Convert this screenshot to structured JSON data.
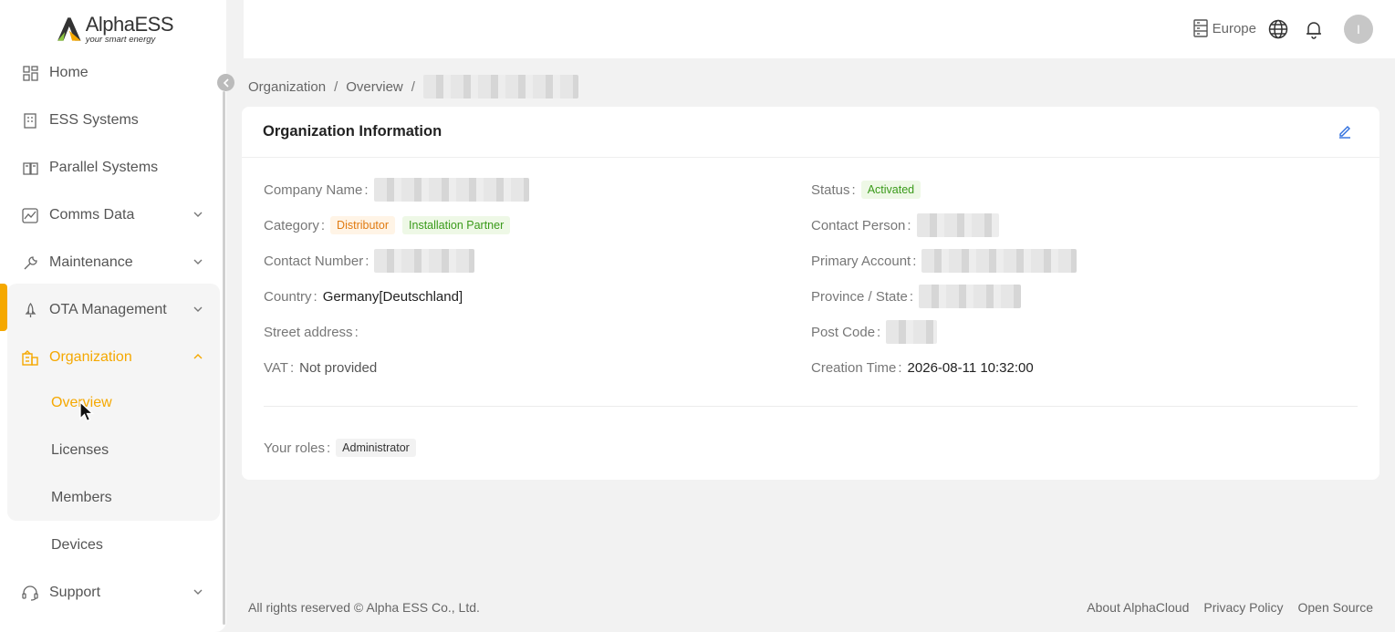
{
  "app": {
    "brand": "AlphaESS",
    "tagline": "your smart energy",
    "accent_color": "#f5a800"
  },
  "header": {
    "region": "Europe",
    "avatar_initial": "I",
    "icons": [
      "server-icon",
      "globe-icon",
      "bell-icon"
    ]
  },
  "sidebar": {
    "items": [
      {
        "label": "Home",
        "icon": "dashboard-icon"
      },
      {
        "label": "ESS Systems",
        "icon": "building-icon"
      },
      {
        "label": "Parallel Systems",
        "icon": "book-icon"
      },
      {
        "label": "Comms Data",
        "icon": "chart-icon",
        "expandable": true
      },
      {
        "label": "Maintenance",
        "icon": "wrench-icon",
        "expandable": true
      },
      {
        "label": "OTA Management",
        "icon": "rocket-icon",
        "expandable": true
      },
      {
        "label": "Organization",
        "icon": "organization-icon",
        "expandable": true,
        "expanded": true,
        "active": true
      },
      {
        "label": "Support",
        "icon": "headset-icon",
        "expandable": true
      }
    ],
    "organization_sub": [
      {
        "label": "Overview",
        "active": true
      },
      {
        "label": "Licenses"
      },
      {
        "label": "Members"
      },
      {
        "label": "Devices"
      }
    ]
  },
  "breadcrumb": [
    "Organization",
    "Overview"
  ],
  "card": {
    "title": "Organization Information",
    "left": {
      "company_name_label": "Company Name",
      "category_label": "Category",
      "category_tags": [
        "Distributor",
        "Installation Partner"
      ],
      "contact_number_label": "Contact Number",
      "country_label": "Country",
      "country_value": "Germany[Deutschland]",
      "street_label": "Street address",
      "vat_label": "VAT",
      "vat_value": "Not provided"
    },
    "right": {
      "status_label": "Status",
      "status_value": "Activated",
      "contact_person_label": "Contact Person",
      "primary_account_label": "Primary Account",
      "province_label": "Province / State",
      "post_code_label": "Post Code",
      "creation_time_label": "Creation Time",
      "creation_time_value": "2026-08-11 10:32:00"
    },
    "roles_label": "Your roles",
    "roles": [
      "Administrator"
    ]
  },
  "footer": {
    "copyright": "All rights reserved © Alpha ESS Co., Ltd.",
    "links": [
      "About AlphaCloud",
      "Privacy Policy",
      "Open Source"
    ]
  }
}
